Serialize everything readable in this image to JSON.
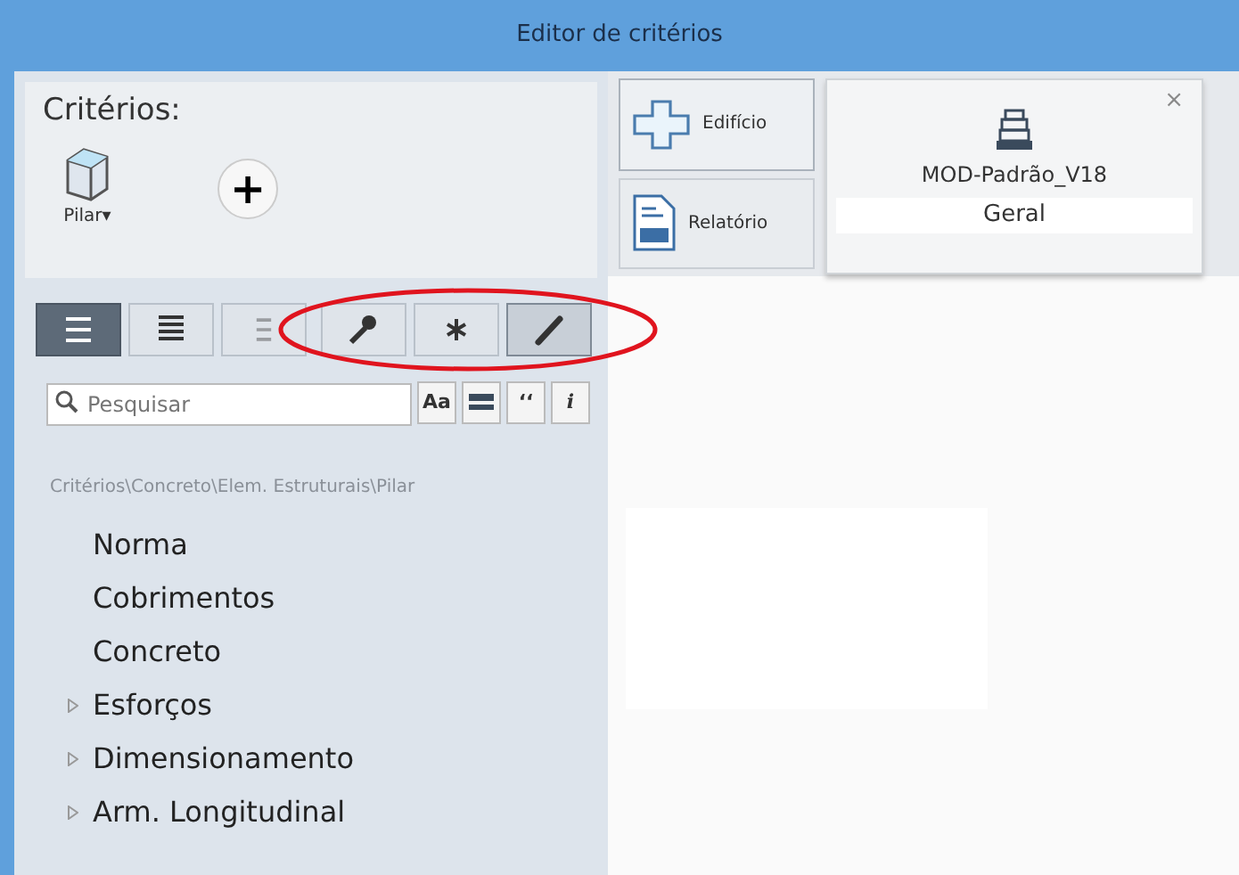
{
  "window": {
    "title": "Editor de critérios"
  },
  "criteria": {
    "heading": "Critérios:",
    "element": {
      "label": "Pilar",
      "caret": "▾"
    },
    "add_button": "+"
  },
  "view_buttons": [
    {
      "kind": "list",
      "selected": true
    },
    {
      "kind": "stack",
      "selected": false
    },
    {
      "kind": "indent",
      "selected": false
    },
    {
      "kind": "key",
      "selected": false
    },
    {
      "kind": "asterisk",
      "selected": false
    },
    {
      "kind": "pencil",
      "selected": true
    }
  ],
  "search": {
    "placeholder": "Pesquisar",
    "options": [
      {
        "kind": "text",
        "label": "Aa"
      },
      {
        "kind": "icon"
      },
      {
        "kind": "text",
        "label": "‘‘"
      },
      {
        "kind": "italic",
        "label": "i"
      }
    ]
  },
  "breadcrumb": "Critérios\\Concreto\\Elem. Estruturais\\Pilar",
  "tree": [
    {
      "label": "Norma",
      "kind": "leaf"
    },
    {
      "label": "Cobrimentos",
      "kind": "leaf"
    },
    {
      "label": "Concreto",
      "kind": "leaf"
    },
    {
      "label": "Esforços",
      "kind": "group"
    },
    {
      "label": "Dimensionamento",
      "kind": "group"
    },
    {
      "label": "Arm. Longitudinal",
      "kind": "group"
    }
  ],
  "nav": [
    {
      "label": "Edifício",
      "kind": "plus",
      "selected": true
    },
    {
      "label": "Relatório",
      "kind": "report",
      "selected": false
    }
  ],
  "model_card": {
    "title": "MOD-Padrão_V18",
    "subtitle": "Geral",
    "close": "×"
  }
}
